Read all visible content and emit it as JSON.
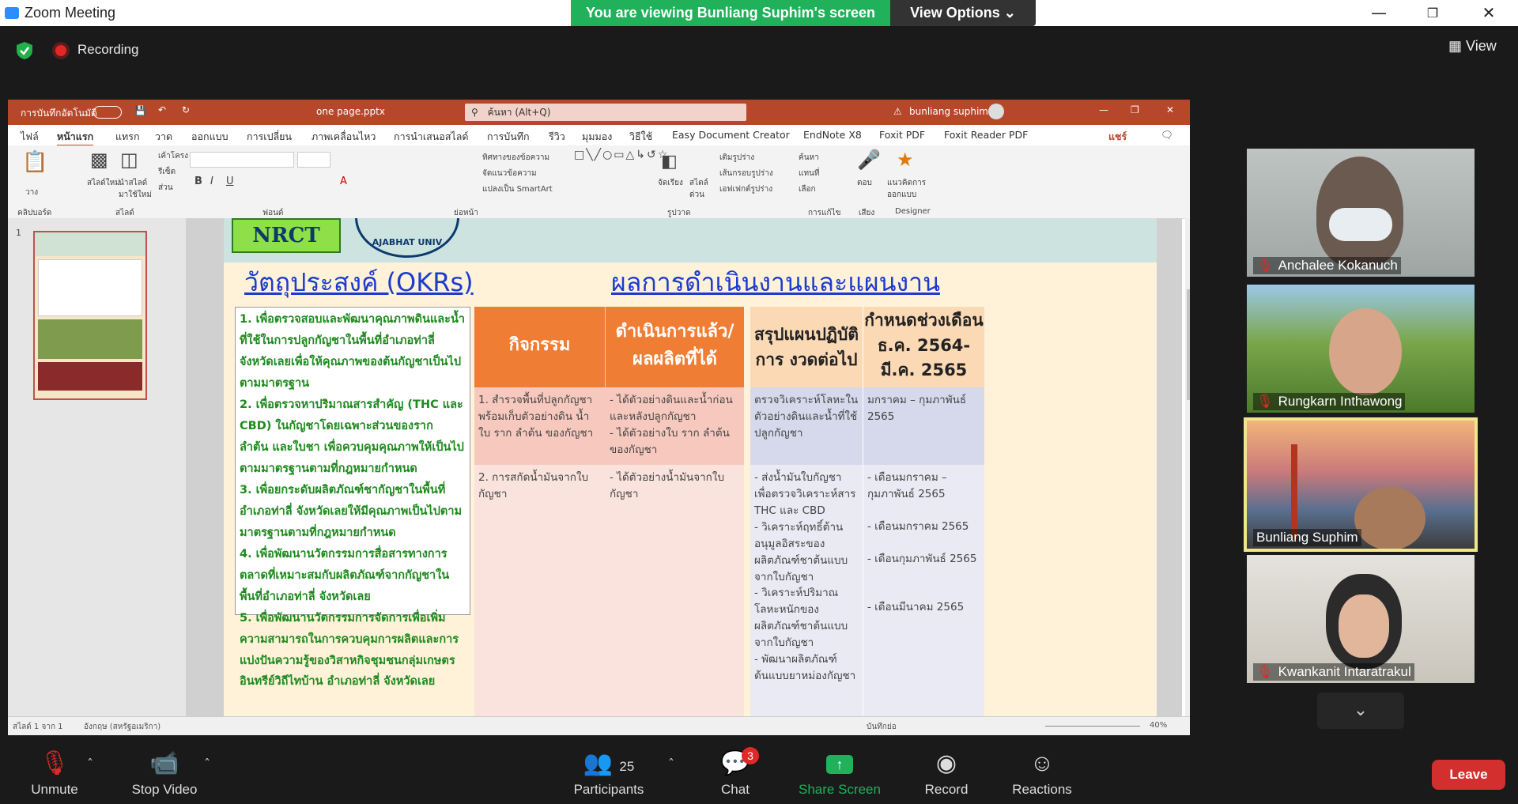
{
  "window": {
    "title": "Zoom Meeting",
    "banner": "You are viewing Bunliang Suphim's screen",
    "view_options": "View Options",
    "recording": "Recording",
    "view_label": "View"
  },
  "ppt": {
    "autosave": "การบันทึกอัตโนมัติ",
    "filename": "one page.pptx",
    "search": "ค้นหา (Alt+Q)",
    "user": "bunliang suphim",
    "menu": [
      "ไฟล์",
      "หน้าแรก",
      "แทรก",
      "วาด",
      "ออกแบบ",
      "การเปลี่ยน",
      "ภาพเคลื่อนไหว",
      "การนำเสนอสไลด์",
      "การบันทึก",
      "รีวิว",
      "มุมมอง",
      "วิธีใช้",
      "Easy Document Creator",
      "EndNote X8",
      "Foxit PDF",
      "Foxit Reader PDF"
    ],
    "share_label": "แชร์",
    "ribbon_groups": [
      "คลิปบอร์ด",
      "สไลด์",
      "ฟอนต์",
      "ย่อหน้า",
      "รูปวาด",
      "การแก้ไข",
      "เสียง",
      "Designer"
    ],
    "ribbon_buttons": {
      "paste": "วาง",
      "new_slide": "สไลด์ใหม่",
      "reuse_slide": "นำสไลด์มาใช้ใหม่",
      "layout": "เค้าโครง",
      "reset": "รีเซ็ต",
      "section": "ส่วน",
      "find": "ค้นหา",
      "replace": "แทนที่",
      "select": "เลือก",
      "dictate": "ตอบ",
      "designer": "แนวคิดการออกแบบ",
      "arrange": "จัดเรียง",
      "quick_styles": "สไตล์ด่วน",
      "text_direction": "ทิศทางของข้อความ",
      "align_text": "จัดแนวข้อความ",
      "smartart": "แปลงเป็น SmartArt",
      "shape_fill": "เติมรูปร่าง",
      "shape_outline": "เส้นกรอบรูปร่าง",
      "shape_effects": "เอฟเฟกต์รูปร่าง"
    },
    "slide_number": "1",
    "status_left": "สไลด์ 1 จาก 1",
    "status_lang": "อังกฤษ (สหรัฐอเมริกา)",
    "notes": "บันทึกย่อ",
    "zoom": "40%"
  },
  "slide": {
    "logo_text": "NRCT",
    "seal_text": "AJABHAT UNIV",
    "okr_title": "วัตถุประสงค์ (OKRs)",
    "results_title": "ผลการดำเนินงานและแผนงาน",
    "okrs": [
      "1. เพื่อตรวจสอบและพัฒนาคุณภาพดินและน้ำที่ใช้ในการปลูกกัญชาในพื้นที่อำเภอท่าลี่ จังหวัดเลยเพื่อให้คุณภาพของต้นกัญชาเป็นไปตามมาตรฐาน",
      "2. เพื่อตรวจหาปริมาณสารสำคัญ (THC และ CBD) ในกัญชาโดยเฉพาะส่วนของราก ลำต้น และใบชา เพื่อควบคุมคุณภาพให้เป็นไปตามมาตรฐานตามที่กฎหมายกำหนด",
      "3. เพื่อยกระดับผลิตภัณฑ์ชากัญชาในพื้นที่อำเภอท่าลี่ จังหวัดเลยให้มีคุณภาพเป็นไปตามมาตรฐานตามที่กฎหมายกำหนด",
      "4. เพื่อพัฒนานวัตกรรมการสื่อสารทางการตลาดที่เหมาะสมกับผลิตภัณฑ์จากกัญชาในพื้นที่อำเภอท่าลี่ จังหวัดเลย",
      "5. เพื่อพัฒนานวัตกรรมการจัดการเพื่อเพิ่มความสามารถในการควบคุมการผลิตและการแบ่งปันความรู้ของวิสาหกิจชุมชนกลุ่มเกษตรอินทรีย์วิถีไทบ้าน อำเภอท่าลี่ จังหวัดเลย"
    ],
    "headers": {
      "activity": "กิจกรรม",
      "done": "ดำเนินการแล้ว/ ผลผลิตที่ได้",
      "plan": "สรุปแผนปฏิบัติการ งวดต่อไป",
      "period": "กำหนดช่วงเดือน ธ.ค. 2564-มี.ค. 2565"
    },
    "row1": {
      "activity": "1. สำรวจพื้นที่ปลูกกัญชาพร้อมเก็บตัวอย่างดิน น้ำ ใบ ราก ลำต้น ของกัญชา",
      "done_a": "- ได้ตัวอย่างดินและน้ำก่อนและหลังปลูกกัญชา",
      "done_b": "- ได้ตัวอย่างใบ ราก ลำต้น ของกัญชา",
      "plan": "ตรวจวิเคราะห์โลหะในตัวอย่างดินและน้ำที่ใช้ปลูกกัญชา",
      "period": "มกราคม – กุมภาพันธ์ 2565"
    },
    "row2": {
      "activity": "2. การสกัดน้ำมันจากใบกัญชา",
      "done": "- ได้ตัวอย่างน้ำมันจากใบกัญชา",
      "plan_a": "- ส่งน้ำมันใบกัญชาเพื่อตรวจวิเคราะห์สาร THC และ CBD",
      "plan_b": "- วิเคราะห์ฤทธิ์ต้านอนุมูลอิสระของผลิตภัณฑ์ชาต้นแบบจากใบกัญชา",
      "plan_c": "- วิเคราะห์ปริมาณโลหะหนักของผลิตภัณฑ์ชาต้นแบบจากใบกัญชา",
      "plan_d": "- พัฒนาผลิตภัณฑ์ต้นแบบยาหม่องกัญชา",
      "period_a": "- เดือนมกราคม – กุมภาพันธ์ 2565",
      "period_b": "- เดือนมกราคม 2565",
      "period_c": "- เดือนกุมภาพันธ์ 2565",
      "period_d": "- เดือนมีนาคม 2565"
    }
  },
  "participants": [
    {
      "name": "Anchalee Kokanuch",
      "muted": true
    },
    {
      "name": "Rungkarn Inthawong",
      "muted": true
    },
    {
      "name": "Bunliang Suphim",
      "muted": false,
      "active_speaker": true
    },
    {
      "name": "Kwankanit Intaratrakul",
      "muted": true
    }
  ],
  "toolbar": {
    "unmute": "Unmute",
    "stop_video": "Stop Video",
    "participants": "Participants",
    "participants_count": "25",
    "chat": "Chat",
    "chat_badge": "3",
    "share_screen": "Share Screen",
    "record": "Record",
    "reactions": "Reactions",
    "leave": "Leave"
  },
  "colors": {
    "banner_green": "#20b15a",
    "ppt_red": "#b7472a",
    "okr_blue": "#1a3ccf",
    "header_orange": "#f07d34",
    "leave_red": "#d32f2f"
  }
}
